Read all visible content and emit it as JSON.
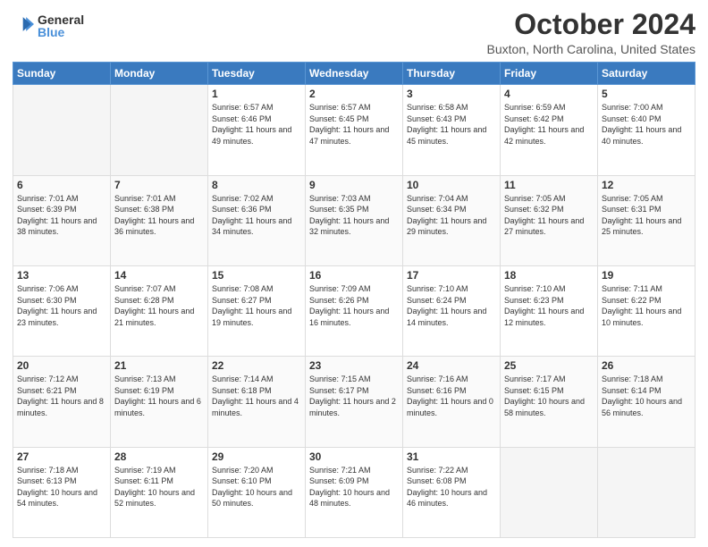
{
  "header": {
    "logo_line1": "General",
    "logo_line2": "Blue",
    "title": "October 2024",
    "subtitle": "Buxton, North Carolina, United States"
  },
  "weekdays": [
    "Sunday",
    "Monday",
    "Tuesday",
    "Wednesday",
    "Thursday",
    "Friday",
    "Saturday"
  ],
  "weeks": [
    [
      {
        "num": "",
        "info": ""
      },
      {
        "num": "",
        "info": ""
      },
      {
        "num": "1",
        "info": "Sunrise: 6:57 AM\nSunset: 6:46 PM\nDaylight: 11 hours and 49 minutes."
      },
      {
        "num": "2",
        "info": "Sunrise: 6:57 AM\nSunset: 6:45 PM\nDaylight: 11 hours and 47 minutes."
      },
      {
        "num": "3",
        "info": "Sunrise: 6:58 AM\nSunset: 6:43 PM\nDaylight: 11 hours and 45 minutes."
      },
      {
        "num": "4",
        "info": "Sunrise: 6:59 AM\nSunset: 6:42 PM\nDaylight: 11 hours and 42 minutes."
      },
      {
        "num": "5",
        "info": "Sunrise: 7:00 AM\nSunset: 6:40 PM\nDaylight: 11 hours and 40 minutes."
      }
    ],
    [
      {
        "num": "6",
        "info": "Sunrise: 7:01 AM\nSunset: 6:39 PM\nDaylight: 11 hours and 38 minutes."
      },
      {
        "num": "7",
        "info": "Sunrise: 7:01 AM\nSunset: 6:38 PM\nDaylight: 11 hours and 36 minutes."
      },
      {
        "num": "8",
        "info": "Sunrise: 7:02 AM\nSunset: 6:36 PM\nDaylight: 11 hours and 34 minutes."
      },
      {
        "num": "9",
        "info": "Sunrise: 7:03 AM\nSunset: 6:35 PM\nDaylight: 11 hours and 32 minutes."
      },
      {
        "num": "10",
        "info": "Sunrise: 7:04 AM\nSunset: 6:34 PM\nDaylight: 11 hours and 29 minutes."
      },
      {
        "num": "11",
        "info": "Sunrise: 7:05 AM\nSunset: 6:32 PM\nDaylight: 11 hours and 27 minutes."
      },
      {
        "num": "12",
        "info": "Sunrise: 7:05 AM\nSunset: 6:31 PM\nDaylight: 11 hours and 25 minutes."
      }
    ],
    [
      {
        "num": "13",
        "info": "Sunrise: 7:06 AM\nSunset: 6:30 PM\nDaylight: 11 hours and 23 minutes."
      },
      {
        "num": "14",
        "info": "Sunrise: 7:07 AM\nSunset: 6:28 PM\nDaylight: 11 hours and 21 minutes."
      },
      {
        "num": "15",
        "info": "Sunrise: 7:08 AM\nSunset: 6:27 PM\nDaylight: 11 hours and 19 minutes."
      },
      {
        "num": "16",
        "info": "Sunrise: 7:09 AM\nSunset: 6:26 PM\nDaylight: 11 hours and 16 minutes."
      },
      {
        "num": "17",
        "info": "Sunrise: 7:10 AM\nSunset: 6:24 PM\nDaylight: 11 hours and 14 minutes."
      },
      {
        "num": "18",
        "info": "Sunrise: 7:10 AM\nSunset: 6:23 PM\nDaylight: 11 hours and 12 minutes."
      },
      {
        "num": "19",
        "info": "Sunrise: 7:11 AM\nSunset: 6:22 PM\nDaylight: 11 hours and 10 minutes."
      }
    ],
    [
      {
        "num": "20",
        "info": "Sunrise: 7:12 AM\nSunset: 6:21 PM\nDaylight: 11 hours and 8 minutes."
      },
      {
        "num": "21",
        "info": "Sunrise: 7:13 AM\nSunset: 6:19 PM\nDaylight: 11 hours and 6 minutes."
      },
      {
        "num": "22",
        "info": "Sunrise: 7:14 AM\nSunset: 6:18 PM\nDaylight: 11 hours and 4 minutes."
      },
      {
        "num": "23",
        "info": "Sunrise: 7:15 AM\nSunset: 6:17 PM\nDaylight: 11 hours and 2 minutes."
      },
      {
        "num": "24",
        "info": "Sunrise: 7:16 AM\nSunset: 6:16 PM\nDaylight: 11 hours and 0 minutes."
      },
      {
        "num": "25",
        "info": "Sunrise: 7:17 AM\nSunset: 6:15 PM\nDaylight: 10 hours and 58 minutes."
      },
      {
        "num": "26",
        "info": "Sunrise: 7:18 AM\nSunset: 6:14 PM\nDaylight: 10 hours and 56 minutes."
      }
    ],
    [
      {
        "num": "27",
        "info": "Sunrise: 7:18 AM\nSunset: 6:13 PM\nDaylight: 10 hours and 54 minutes."
      },
      {
        "num": "28",
        "info": "Sunrise: 7:19 AM\nSunset: 6:11 PM\nDaylight: 10 hours and 52 minutes."
      },
      {
        "num": "29",
        "info": "Sunrise: 7:20 AM\nSunset: 6:10 PM\nDaylight: 10 hours and 50 minutes."
      },
      {
        "num": "30",
        "info": "Sunrise: 7:21 AM\nSunset: 6:09 PM\nDaylight: 10 hours and 48 minutes."
      },
      {
        "num": "31",
        "info": "Sunrise: 7:22 AM\nSunset: 6:08 PM\nDaylight: 10 hours and 46 minutes."
      },
      {
        "num": "",
        "info": ""
      },
      {
        "num": "",
        "info": ""
      }
    ]
  ]
}
